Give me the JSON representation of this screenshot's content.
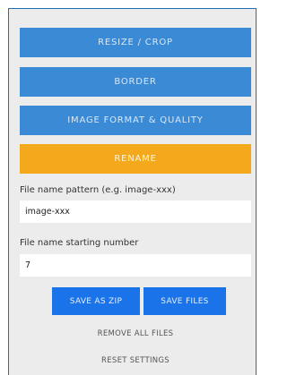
{
  "panels": {
    "resize_crop": "RESIZE / CROP",
    "border": "BORDER",
    "image_format_quality": "IMAGE FORMAT & QUALITY",
    "rename": "RENAME"
  },
  "rename": {
    "pattern_label": "File name pattern (e.g. image-xxx)",
    "pattern_value": "image-xxx",
    "start_label": "File name starting number",
    "start_value": "7"
  },
  "actions": {
    "save_zip": "SAVE AS ZIP",
    "save_files": "SAVE FILES",
    "remove_all": "REMOVE ALL FILES",
    "reset_settings": "RESET SETTINGS"
  },
  "colors": {
    "accordion_blue": "#3a8ad6",
    "accordion_active_orange": "#f3a91b",
    "action_blue": "#1a73e8",
    "panel_bg": "#ececec"
  }
}
